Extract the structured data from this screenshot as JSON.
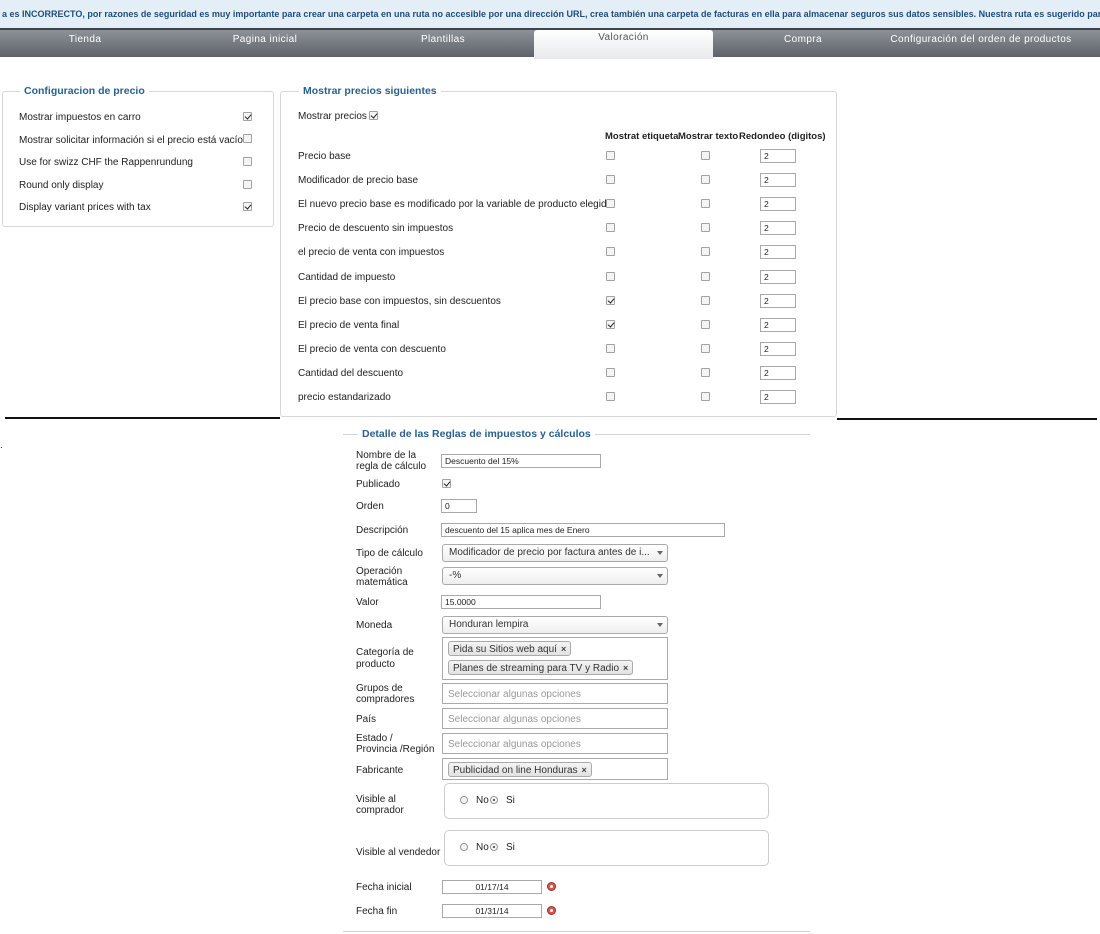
{
  "warning_text": "a es INCORRECTO, por razones de seguridad es muy importante para crear una carpeta en una ruta no accesible por una dirección URL, crea también una carpeta de facturas en ella para almacenar seguros sus datos sensibles. Nuestra ruta es sugerido para su sistema",
  "tabs": [
    {
      "label": "Tienda"
    },
    {
      "label": "Pagina inicial"
    },
    {
      "label": "Plantillas"
    },
    {
      "label": "Valoración"
    },
    {
      "label": "Compra"
    },
    {
      "label": "Configuración del orden de productos"
    }
  ],
  "price_config": {
    "legend": "Configuracion de precio",
    "options": [
      {
        "label": "Mostrar impuestos en carro",
        "checked": true
      },
      {
        "label": "Mostrar solicitar información si el precio está vacío",
        "checked": false
      },
      {
        "label": "Use for swizz CHF the Rappenrundung",
        "checked": false
      },
      {
        "label": "Round only display",
        "checked": false
      },
      {
        "label": "Display variant prices with tax",
        "checked": true
      }
    ]
  },
  "show_prices": {
    "legend": "Mostrar precios siguientes",
    "show_label": "Mostrar precios",
    "show_checked": true,
    "columns": [
      "Mostrat etiqueta",
      "Mostrar texto",
      "Redondeo (digitos)"
    ],
    "rows": [
      {
        "label": "Precio base",
        "label_checked": false,
        "text_checked": false,
        "rounding": "2"
      },
      {
        "label": "Modificador de precio base",
        "label_checked": false,
        "text_checked": false,
        "rounding": "2"
      },
      {
        "label": "El nuevo precio base es modificado por la variable de producto elegida",
        "label_checked": false,
        "text_checked": false,
        "rounding": "2"
      },
      {
        "label": "Precio de descuento sin impuestos",
        "label_checked": false,
        "text_checked": false,
        "rounding": "2"
      },
      {
        "label": "el precio de venta con impuestos",
        "label_checked": false,
        "text_checked": false,
        "rounding": "2"
      },
      {
        "label": "Cantidad de impuesto",
        "label_checked": false,
        "text_checked": false,
        "rounding": "2"
      },
      {
        "label": "El precio base con impuestos, sin descuentos",
        "label_checked": true,
        "text_checked": false,
        "rounding": "2"
      },
      {
        "label": "El precio de venta final",
        "label_checked": true,
        "text_checked": false,
        "rounding": "2"
      },
      {
        "label": "El precio de venta con descuento",
        "label_checked": false,
        "text_checked": false,
        "rounding": "2"
      },
      {
        "label": "Cantidad del descuento",
        "label_checked": false,
        "text_checked": false,
        "rounding": "2"
      },
      {
        "label": "precio estandarizado",
        "label_checked": false,
        "text_checked": false,
        "rounding": "2"
      }
    ]
  },
  "tax_rule": {
    "legend": "Detalle de las Reglas de impuestos y cálculos",
    "stray_mark": ".",
    "name_label": "Nombre de la regla de cálculo",
    "name_value": "Descuento del 15%",
    "published_label": "Publicado",
    "published_checked": true,
    "order_label": "Orden",
    "order_value": "0",
    "description_label": "Descripción",
    "description_value": "descuento del 15 aplica mes de Enero",
    "calc_type_label": "Tipo de cálculo",
    "calc_type_value": "Modificador de precio por factura antes de i...",
    "operation_label": "Operación matemática",
    "operation_value": "-%",
    "value_label": "Valor",
    "value_value": "15.0000",
    "currency_label": "Moneda",
    "currency_value": "Honduran lempira",
    "category_label": "Categoría de producto",
    "categories": [
      "Pida su Sitios web aquí",
      "Planes de streaming para TV y Radio"
    ],
    "buyer_groups_label": "Grupos de compradores",
    "buyer_groups_placeholder": "Seleccionar algunas opciones",
    "country_label": "País",
    "country_placeholder": "Seleccionar algunas opciones",
    "state_label": "Estado / Provincia /Región",
    "state_placeholder": "Seleccionar algunas opciones",
    "manufacturer_label": "Fabricante",
    "manufacturers": [
      "Publicidad on line Honduras"
    ],
    "chip_remove": "×",
    "visible_buyer_label": "Visible al comprador",
    "visible_vendor_label": "Visible al vendedor",
    "radio_no": "No",
    "radio_yes": "Si",
    "visible_buyer_value": "Si",
    "visible_vendor_value": "Si",
    "start_date_label": "Fecha inicial",
    "start_date_value": "01/17/14",
    "end_date_label": "Fecha fin",
    "end_date_value": "01/31/14"
  },
  "colors": {
    "legend": "#2b5f8e",
    "tabbar": "#6d7378",
    "warning_bg": "#e3eef7",
    "date_icon": "#d9534f"
  }
}
